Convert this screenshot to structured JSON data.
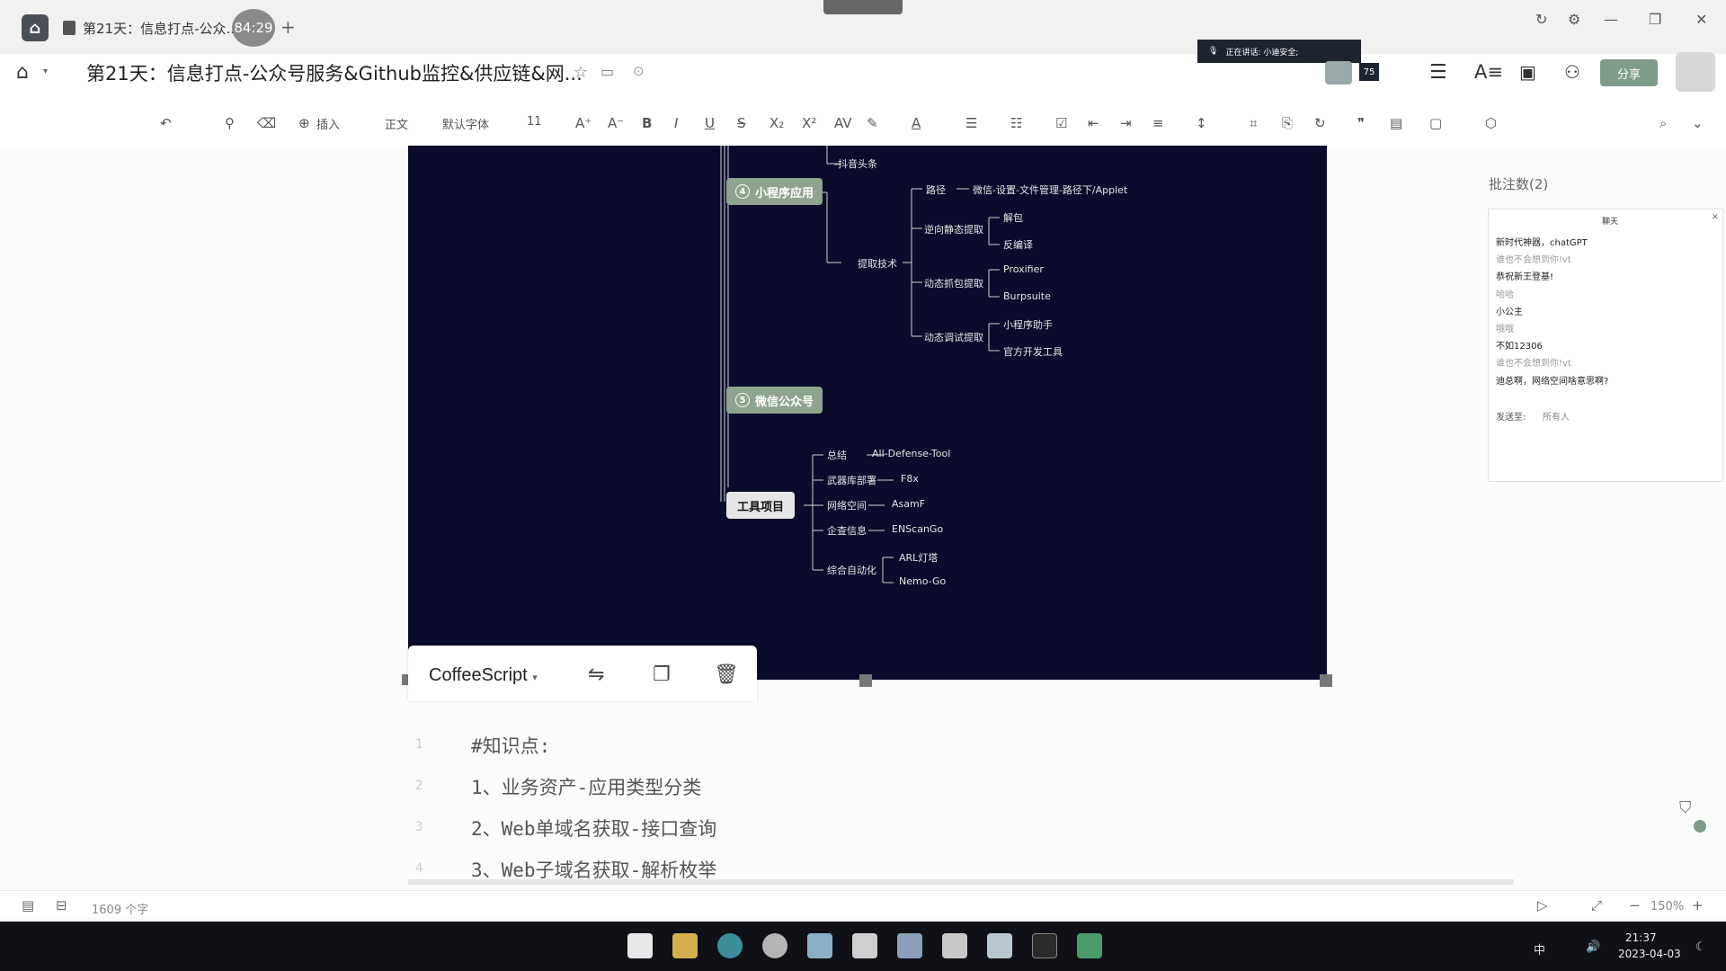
{
  "tab": {
    "title": "第21天：信息打点-公众...",
    "timer": "84:29",
    "new_tab": "+"
  },
  "header": {
    "doc_title": "第21天：信息打点-公众号服务&Github监控&供应链&网...",
    "share": "分享",
    "live_banner": "正在讲话: 小迪安全;",
    "count_badge": "75"
  },
  "toolbar": {
    "insert": "插入",
    "style": "正文",
    "font": "默认字体",
    "size": "11"
  },
  "mindmap": {
    "top_leaf": "-抖音头条",
    "node4": {
      "num": "4",
      "label": "小程序应用"
    },
    "path_label": "路径",
    "path_value": "微信-设置-文件管理-路径下/Applet",
    "extract_tech": "提取技术",
    "reverse_static": "逆向静态提取",
    "unpack": "解包",
    "decompile": "反编译",
    "dynamic_capture": "动态抓包提取",
    "proxifier": "Proxifier",
    "burpsuite": "Burpsuite",
    "dynamic_debug": "动态调试提取",
    "mini_helper": "小程序助手",
    "official_tool": "官方开发工具",
    "node5": {
      "num": "5",
      "label": "微信公众号"
    },
    "tools_node": "工具项目",
    "summary": "总结",
    "summary_value": "All-Defense-Tool",
    "arsenal": "武器库部署",
    "arsenal_value": "F8x",
    "cyberspace": "网络空间",
    "cyberspace_value": "AsamF",
    "enterprise": "企查信息",
    "enterprise_value": "ENScanGo",
    "automation": "综合自动化",
    "arl": "ARL灯塔",
    "nemo": "Nemo-Go"
  },
  "code": {
    "language": "CoffeeScript",
    "lines": [
      {
        "no": "1",
        "text": "#知识点:"
      },
      {
        "no": "2",
        "text": "1、业务资产-应用类型分类"
      },
      {
        "no": "3",
        "text": "2、Web单域名获取-接口查询"
      },
      {
        "no": "4",
        "text": "3、Web子域名获取-解析枚举"
      }
    ]
  },
  "sidebar": {
    "comments_title": "批注数(2)",
    "chat_title": "聊天",
    "messages": [
      {
        "text": "新时代神器，chatGPT",
        "faint": false
      },
      {
        "text": "谁也不会想到你!vt",
        "faint": true
      },
      {
        "text": "恭祝新王登基!",
        "faint": false
      },
      {
        "text": "哈哈",
        "faint": true
      },
      {
        "text": "小公主",
        "faint": false
      },
      {
        "text": "哦哦",
        "faint": true
      },
      {
        "text": "不如12306",
        "faint": false
      },
      {
        "text": "谁也不会想到你!vt",
        "faint": true
      },
      {
        "text": "迪总啊，网络空间啥意思啊?",
        "faint": false
      }
    ],
    "send_to": "发送至:",
    "send_target": "所有人"
  },
  "status": {
    "word_count": "1609 个字",
    "zoom": "150%"
  },
  "clock": {
    "time": "21:37",
    "date": "2023-04-03",
    "ime": "中"
  }
}
